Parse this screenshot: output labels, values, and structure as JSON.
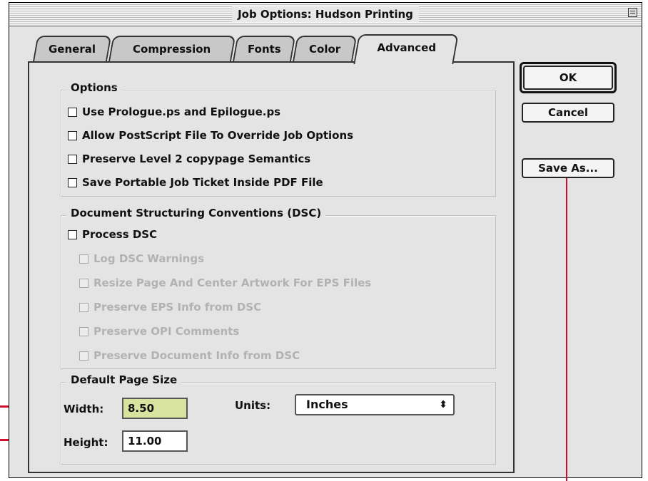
{
  "window": {
    "title": "Job Options: Hudson Printing"
  },
  "tabs": [
    {
      "label": "General"
    },
    {
      "label": "Compression"
    },
    {
      "label": "Fonts"
    },
    {
      "label": "Color"
    },
    {
      "label": "Advanced",
      "active": true
    }
  ],
  "options": {
    "heading": "Options",
    "items": [
      {
        "label": "Use Prologue.ps and Epilogue.ps",
        "checked": false
      },
      {
        "label": "Allow PostScript File To Override Job Options",
        "checked": false
      },
      {
        "label": "Preserve Level 2 copypage Semantics",
        "checked": false
      },
      {
        "label": "Save Portable Job Ticket Inside PDF File",
        "checked": false
      }
    ]
  },
  "dsc": {
    "heading": "Document Structuring Conventions (DSC)",
    "process_label": "Process DSC",
    "sub_items": [
      {
        "label": "Log DSC Warnings",
        "enabled": false
      },
      {
        "label": "Resize Page And Center Artwork For EPS Files",
        "enabled": false
      },
      {
        "label": "Preserve EPS Info from DSC",
        "enabled": false
      },
      {
        "label": "Preserve OPI Comments",
        "enabled": false
      },
      {
        "label": "Preserve Document Info from DSC",
        "enabled": false
      }
    ]
  },
  "page_size": {
    "heading": "Default Page Size",
    "width_label": "Width:",
    "width_value": "8.50",
    "height_label": "Height:",
    "height_value": "11.00",
    "units_label": "Units:",
    "units_value": "Inches"
  },
  "buttons": {
    "ok": "OK",
    "cancel": "Cancel",
    "save_as": "Save As..."
  },
  "colors": {
    "annotation": "#cc1133",
    "focused_field": "#d9e3a0"
  }
}
